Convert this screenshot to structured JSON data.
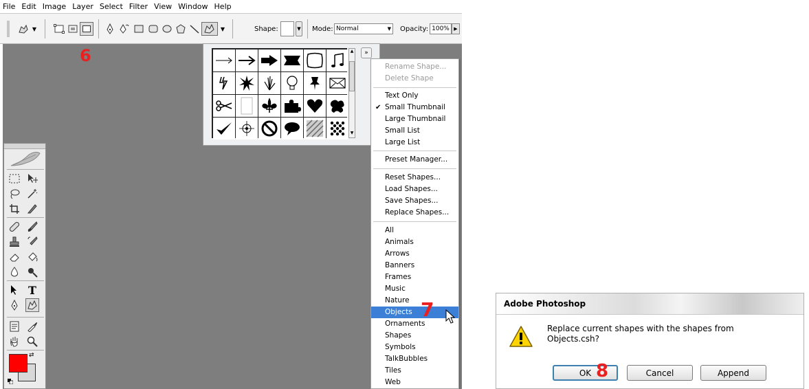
{
  "menubar": [
    "File",
    "Edit",
    "Image",
    "Layer",
    "Select",
    "Filter",
    "View",
    "Window",
    "Help"
  ],
  "options_bar": {
    "shape_label": "Shape:",
    "mode_label": "Mode:",
    "mode_value": "Normal",
    "opacity_label": "Opacity:",
    "opacity_value": "100%"
  },
  "steps": {
    "six": "6",
    "seven": "7",
    "eight": "8"
  },
  "picker": {
    "icons": [
      "arrow-thin-icon",
      "arrow-icon",
      "arrow-bold-icon",
      "banner-icon",
      "frame-icon",
      "music-note-icon",
      "lightning-icon",
      "starburst-icon",
      "grass-icon",
      "lightbulb-icon",
      "pushpin-icon",
      "envelope-icon",
      "scissors-icon",
      "blank-page-icon",
      "fleur-de-lis-icon",
      "puzzle-icon",
      "heart-icon",
      "blob-icon",
      "checkmark-icon",
      "target-icon",
      "no-sign-icon",
      "speech-bubble-icon",
      "hatch-pattern-icon",
      "dot-grid-icon"
    ]
  },
  "shape_menu": {
    "group1": [
      "Rename Shape...",
      "Delete Shape"
    ],
    "group2": [
      "Text Only",
      "Small Thumbnail",
      "Large Thumbnail",
      "Small List",
      "Large List"
    ],
    "checked": "Small Thumbnail",
    "group3": [
      "Preset Manager..."
    ],
    "group4": [
      "Reset Shapes...",
      "Load Shapes...",
      "Save Shapes...",
      "Replace Shapes..."
    ],
    "group5": [
      "All",
      "Animals",
      "Arrows",
      "Banners",
      "Frames",
      "Music",
      "Nature",
      "Objects",
      "Ornaments",
      "Shapes",
      "Symbols",
      "TalkBubbles",
      "Tiles",
      "Web"
    ],
    "selected": "Objects"
  },
  "colors": {
    "foreground": "#ff0000",
    "background": "#d8d8d8",
    "highlight": "#3b80d6",
    "step_red": "#ea1f1f"
  },
  "dialog": {
    "title": "Adobe Photoshop",
    "message_line1": "Replace current shapes with the shapes from",
    "message_line2": "Objects.csh?",
    "ok": "OK",
    "cancel": "Cancel",
    "append": "Append"
  }
}
